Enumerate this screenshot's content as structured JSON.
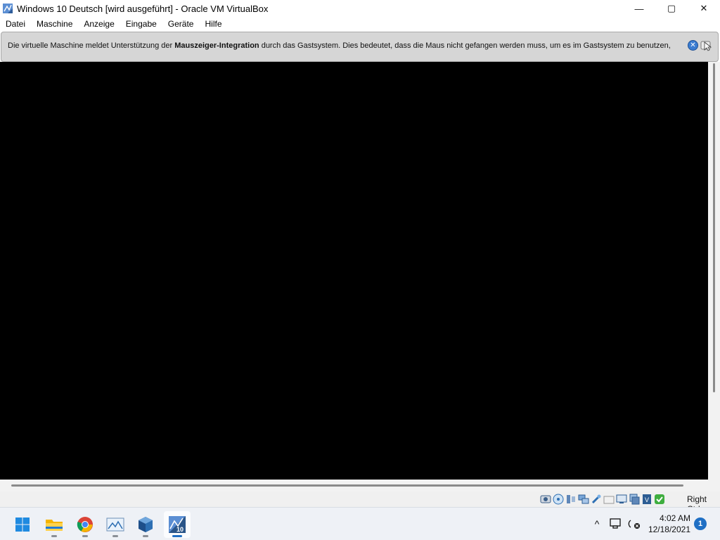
{
  "window": {
    "title": "Windows 10 Deutsch [wird ausgeführt] - Oracle VM VirtualBox",
    "controls": {
      "minimize": "—",
      "maximize": "▢",
      "close": "✕"
    }
  },
  "menu": {
    "items": [
      "Datei",
      "Maschine",
      "Anzeige",
      "Eingabe",
      "Geräte",
      "Hilfe"
    ]
  },
  "notice": {
    "text_before": "Die virtuelle Maschine meldet Unterstützung der ",
    "text_bold": "Mauszeiger-Integration",
    "text_after": " durch das Gastsystem. Dies bedeutet, dass die Maus nicht gefangen werden muss, um es im Gastsystem zu benutzen,",
    "close_glyph": "✕"
  },
  "statusbar": {
    "host_key": "Right Ctrl",
    "icons": [
      "hard-disk-icon",
      "optical-drive-icon",
      "audio-icon",
      "network-icon",
      "usb-icon",
      "shared-folders-icon",
      "display-icon",
      "recording-icon",
      "virtualization-icon",
      "mouse-integration-icon"
    ]
  },
  "taskbar": {
    "apps": [
      "start-icon",
      "file-explorer-icon",
      "chrome-icon",
      "image-viewer-icon",
      "virtualbox-manager-icon",
      "virtualbox-vm-icon"
    ],
    "tray_chevron": "^",
    "time": "4:02 AM",
    "date": "12/18/2021",
    "notification_count": "1"
  },
  "colors": {
    "vm_screen": "#000000",
    "notice_bg": "#d6d6d6",
    "taskbar_bg": "#eef1f6",
    "accent": "#1f6fc4"
  }
}
